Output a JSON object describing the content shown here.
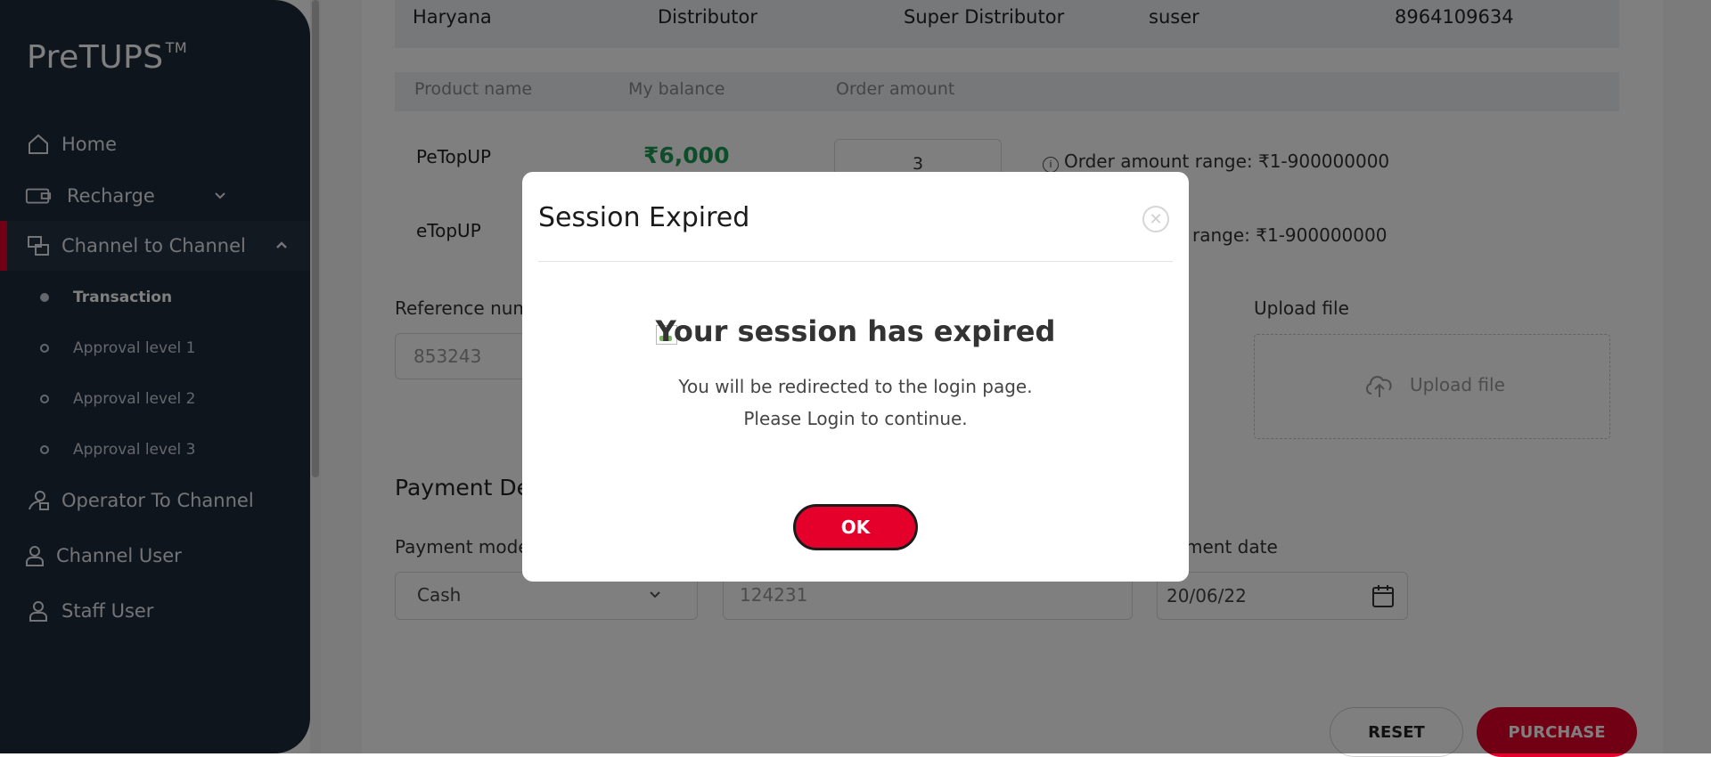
{
  "app": {
    "logo": "PreTUPS",
    "logo_mark": "TM"
  },
  "sidebar": {
    "items": [
      {
        "label": "Home",
        "icon": "home-icon"
      },
      {
        "label": "Recharge",
        "icon": "wallet-icon"
      },
      {
        "label": "Channel to Channel",
        "icon": "transfer-icon"
      },
      {
        "label": "Operator To Channel",
        "icon": "operator-icon"
      },
      {
        "label": "Channel User",
        "icon": "user-icon"
      },
      {
        "label": "Staff User",
        "icon": "staff-icon"
      }
    ],
    "subitems": [
      {
        "label": "Transaction"
      },
      {
        "label": "Approval level 1"
      },
      {
        "label": "Approval level 2"
      },
      {
        "label": "Approval level 3"
      }
    ]
  },
  "channel_row": {
    "state": "Haryana",
    "category": "Distributor",
    "parent": "Super Distributor",
    "user": "suser",
    "mobile": "8964109634"
  },
  "products": {
    "headers": [
      "Product name",
      "My balance",
      "Order amount"
    ],
    "rows": [
      {
        "name": "PeTopUP",
        "balance": "₹6,000",
        "order": "3",
        "range": "Order amount range: ₹1-900000000"
      },
      {
        "name": "eTopUP",
        "range_partial": "range: ₹1-900000000"
      }
    ]
  },
  "reference": {
    "label": "Reference num",
    "value": "853243"
  },
  "upload": {
    "label": "Upload file",
    "button": "Upload file"
  },
  "payment": {
    "section_title": "Payment De",
    "mode_label": "Payment mode",
    "mode_value": "Cash",
    "instrument_value": "124231",
    "date_label": "ment date",
    "date_value": "20/06/22"
  },
  "actions": {
    "reset": "RESET",
    "purchase": "PURCHASE"
  },
  "modal": {
    "title": "Session Expired",
    "heading": "Your session has expired",
    "line1": "You will be redirected to the login page.",
    "line2": "Please Login to continue.",
    "ok": "OK"
  },
  "colors": {
    "accent": "#e4002b",
    "sidebar": "#1e2a38",
    "balance": "#1a9b52"
  }
}
